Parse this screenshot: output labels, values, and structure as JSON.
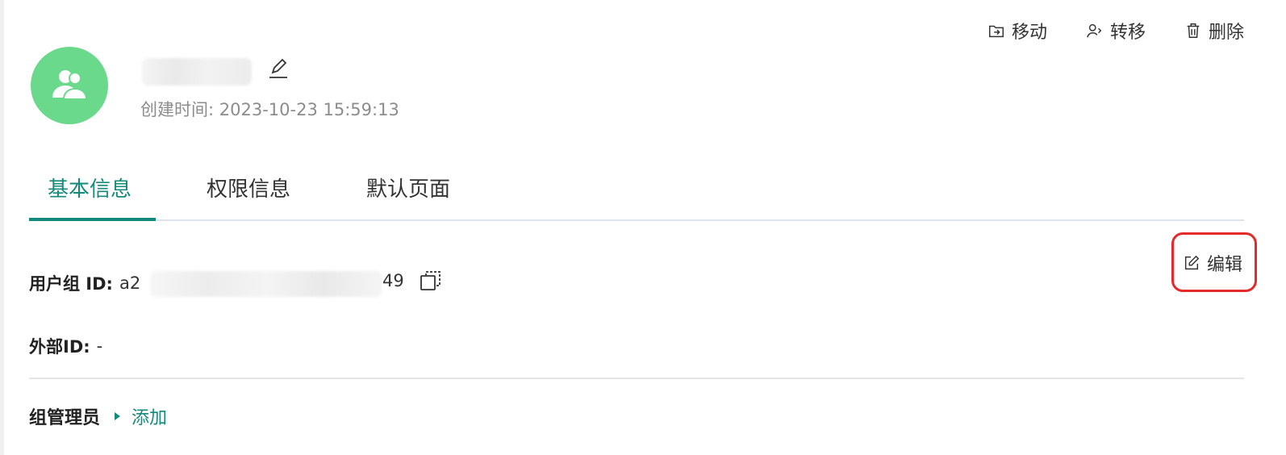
{
  "top_actions": {
    "move_label": "移动",
    "transfer_label": "转移",
    "delete_label": "删除"
  },
  "header": {
    "created_label": "创建时间:",
    "created_value": "2023-10-23 15:59:13"
  },
  "tabs": [
    {
      "label": "基本信息",
      "active": true
    },
    {
      "label": "权限信息",
      "active": false
    },
    {
      "label": "默认页面",
      "active": false
    }
  ],
  "edit_label": "编辑",
  "fields": {
    "group_id_label": "用户组 ID:",
    "group_id_prefix": "a2",
    "group_id_suffix": "49",
    "external_id_label": "外部ID:",
    "external_id_value": "-"
  },
  "admins": {
    "label": "组管理员",
    "add_label": "添加"
  },
  "colors": {
    "accent": "#138a7a",
    "avatar": "#6bd98c",
    "highlight": "#e52a2a"
  }
}
